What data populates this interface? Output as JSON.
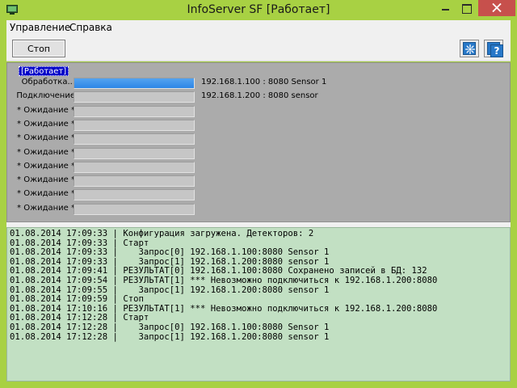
{
  "window": {
    "title": "InfoServer SF [Работает]"
  },
  "menu": {
    "items": [
      "Управление",
      "Справка"
    ]
  },
  "toolbar": {
    "stop_label": "Стоп",
    "settings_icon": "settings-icon",
    "help_icon": "help-icon",
    "help_glyph": "?"
  },
  "status": {
    "state": "[Работает]",
    "rows": [
      {
        "label": "Обработка...",
        "progress": 1.0,
        "address": "192.168.1.100 : 8080  Sensor 1"
      },
      {
        "label": "Подключение",
        "progress": 0,
        "address": "192.168.1.200 : 8080  sensor"
      },
      {
        "label": "* Ожидание *",
        "progress": 0,
        "address": ""
      },
      {
        "label": "* Ожидание *",
        "progress": 0,
        "address": ""
      },
      {
        "label": "* Ожидание *",
        "progress": 0,
        "address": ""
      },
      {
        "label": "* Ожидание *",
        "progress": 0,
        "address": ""
      },
      {
        "label": "* Ожидание *",
        "progress": 0,
        "address": ""
      },
      {
        "label": "* Ожидание *",
        "progress": 0,
        "address": ""
      },
      {
        "label": "* Ожидание *",
        "progress": 0,
        "address": ""
      },
      {
        "label": "* Ожидание *",
        "progress": 0,
        "address": ""
      }
    ]
  },
  "log": {
    "lines": [
      "01.08.2014 17:09:33 | Конфигурация загружена. Детекторов: 2",
      "01.08.2014 17:09:33 | Старт",
      "01.08.2014 17:09:33 |    Запрос[0] 192.168.1.100:8080 Sensor 1",
      "01.08.2014 17:09:33 |    Запрос[1] 192.168.1.200:8080 sensor 1",
      "01.08.2014 17:09:41 | РЕЗУЛЬТАТ[0] 192.168.1.100:8080 Сохранено записей в БД: 132",
      "01.08.2014 17:09:54 | РЕЗУЛЬТАТ[1] *** Невозможно подключиться к 192.168.1.200:8080",
      "01.08.2014 17:09:55 |    Запрос[1] 192.168.1.200:8080 sensor 1",
      "01.08.2014 17:09:59 | Стоп",
      "01.08.2014 17:10:16 | РЕЗУЛЬТАТ[1] *** Невозможно подключиться к 192.168.1.200:8080",
      "01.08.2014 17:12:28 | Старт",
      "01.08.2014 17:12:28 |    Запрос[0] 192.168.1.100:8080 Sensor 1",
      "01.08.2014 17:12:28 |    Запрос[1] 192.168.1.200:8080 sensor 1"
    ]
  }
}
